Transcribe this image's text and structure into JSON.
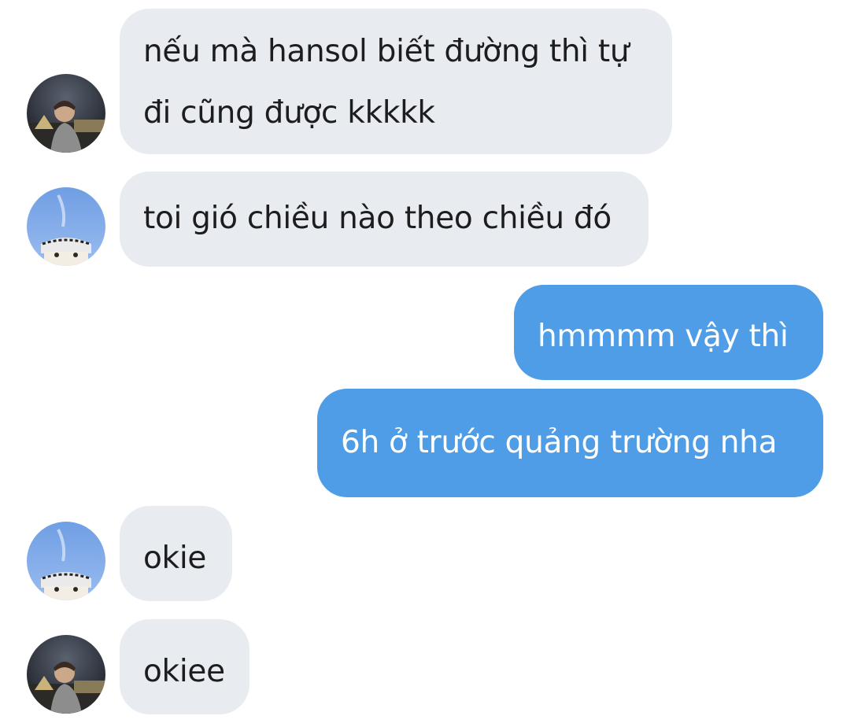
{
  "conversation": {
    "messages": [
      {
        "sender": "other_a",
        "lines": [
          "nếu mà hansol biết đường thì tự",
          "đi cũng được kkkkk"
        ]
      },
      {
        "sender": "other_b",
        "lines": [
          "toi gió chiều nào theo chiều đó"
        ]
      },
      {
        "sender": "me",
        "lines": [
          "hmmmm vậy thì"
        ]
      },
      {
        "sender": "me",
        "lines": [
          "6h ở trước quảng trường nha"
        ]
      },
      {
        "sender": "other_b",
        "lines": [
          "okie"
        ]
      },
      {
        "sender": "other_a",
        "lines": [
          "okiee"
        ]
      }
    ]
  },
  "colors": {
    "incoming_bubble": "#e8ecf0",
    "outgoing_bubble": "#4f9de6",
    "incoming_text": "#1d1d1f",
    "outgoing_text": "#ffffff"
  },
  "avatars": {
    "other_a": "avatar-night-louvre-photo",
    "other_b": "avatar-blue-sky-photo"
  }
}
